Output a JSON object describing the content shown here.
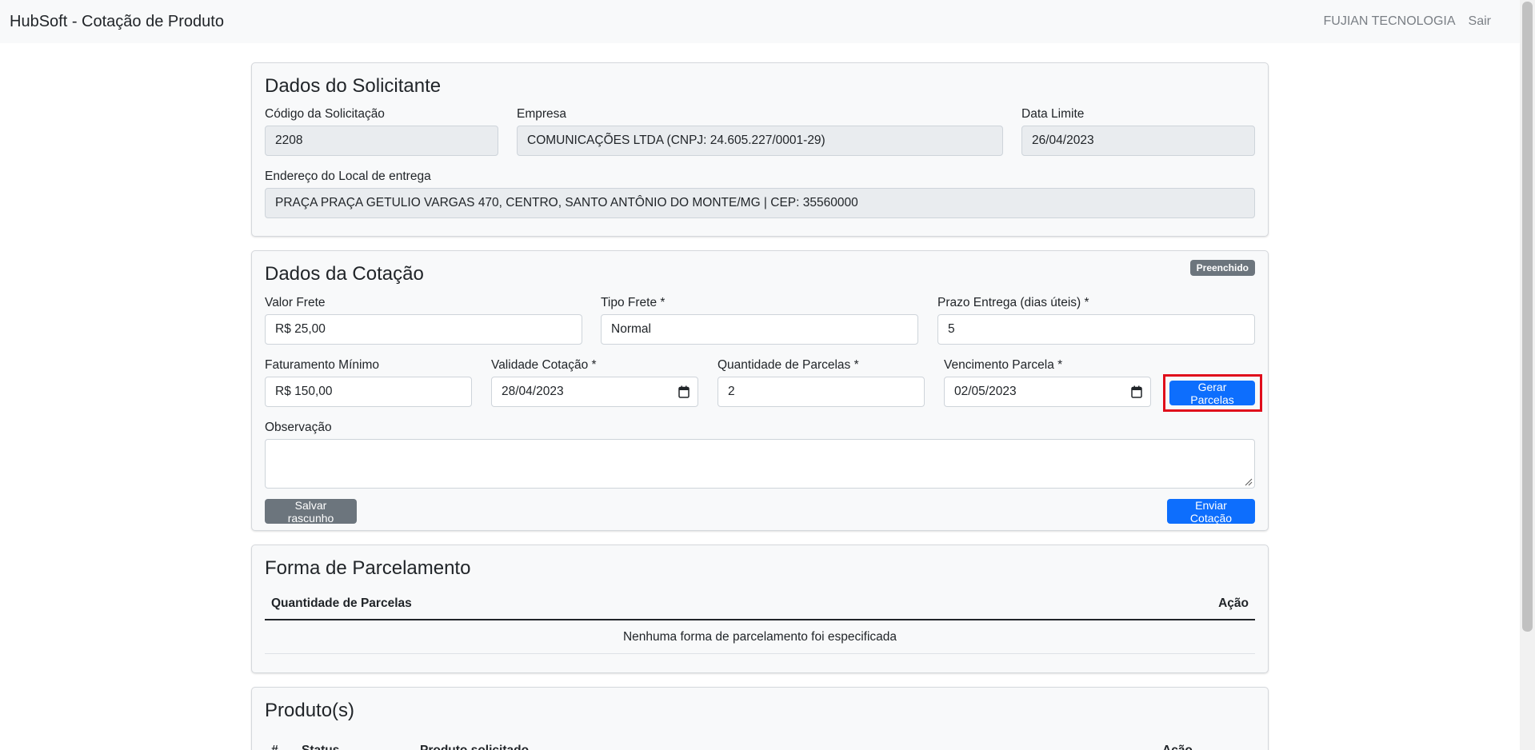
{
  "navbar": {
    "brand": "HubSoft - Cotação de Produto",
    "company": "FUJIAN TECNOLOGIA",
    "logout": "Sair"
  },
  "solicitante": {
    "title": "Dados do Solicitante",
    "codigo_label": "Código da Solicitação",
    "codigo_value": "2208",
    "empresa_label": "Empresa",
    "empresa_value": "COMUNICAÇÕES LTDA (CNPJ: 24.605.227/0001-29)",
    "data_limite_label": "Data Limite",
    "data_limite_value": "26/04/2023",
    "endereco_label": "Endereço do Local de entrega",
    "endereco_value": "PRAÇA PRAÇA GETULIO VARGAS 470, CENTRO, SANTO ANTÔNIO DO MONTE/MG | CEP: 35560000"
  },
  "cotacao": {
    "title": "Dados da Cotação",
    "badge": "Preenchido",
    "valor_frete_label": "Valor Frete",
    "valor_frete_value": "R$ 25,00",
    "tipo_frete_label": "Tipo Frete *",
    "tipo_frete_value": "Normal",
    "prazo_label": "Prazo Entrega (dias úteis) *",
    "prazo_value": "5",
    "faturamento_label": "Faturamento Mínimo",
    "faturamento_value": "R$ 150,00",
    "validade_label": "Validade Cotação *",
    "validade_value": "28/04/2023",
    "qtd_parcelas_label": "Quantidade de Parcelas *",
    "qtd_parcelas_value": "2",
    "vencimento_label": "Vencimento Parcela *",
    "vencimento_value": "02/05/2023",
    "gerar_parcelas": "Gerar Parcelas",
    "observacao_label": "Observação",
    "observacao_value": "",
    "salvar_rascunho": "Salvar rascunho",
    "enviar_cotacao": "Enviar Cotação"
  },
  "parcelamento": {
    "title": "Forma de Parcelamento",
    "col_quantidade": "Quantidade de Parcelas",
    "col_acao": "Ação",
    "empty_message": "Nenhuma forma de parcelamento foi especificada"
  },
  "produtos": {
    "title": "Produto(s)",
    "col_hash": "#",
    "col_status": "Status",
    "col_produto": "Produto solicitado",
    "col_acao": "Ação"
  },
  "colors": {
    "primary": "#0d6efd",
    "secondary": "#6c757d",
    "highlight": "#e00d1b",
    "card_bg": "#f8f9fa"
  }
}
